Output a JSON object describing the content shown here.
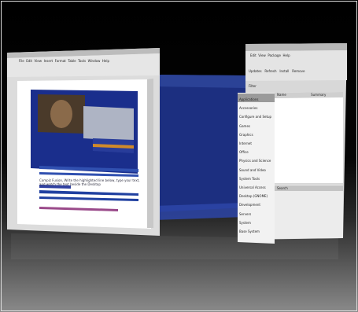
{
  "writer": {
    "menu": [
      "File",
      "Edit",
      "View",
      "Insert",
      "Format",
      "Table",
      "Tools",
      "Window",
      "Help"
    ],
    "doc_text": "Compiz Fusion, Write the highlighted line below, type your text, and watch the text beside the Desktop"
  },
  "package_manager": {
    "menu": [
      "Edit",
      "View",
      "Package",
      "Help"
    ],
    "toolbar": [
      "Updates",
      "Refresh",
      "Install",
      "Remove"
    ],
    "filter_label": "Filter",
    "categories": [
      "Applications",
      "Accessories",
      "Configure and Setup",
      "Games",
      "Graphics",
      "Internet",
      "Office",
      "Physics and Science",
      "Sound and Video",
      "System Tools",
      "Universal Access",
      "Desktop (GNOME)",
      "Development",
      "Servers",
      "System",
      "Base System"
    ],
    "columns": [
      "Name",
      "Summary"
    ],
    "status_text": "Search"
  }
}
